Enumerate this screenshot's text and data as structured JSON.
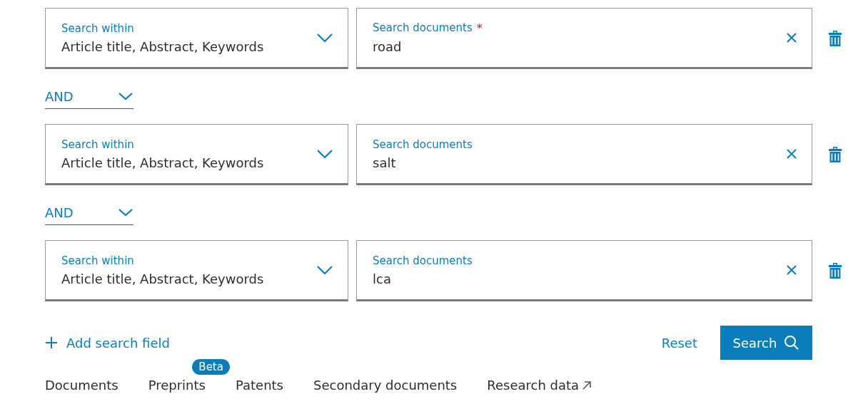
{
  "rows": [
    {
      "within": {
        "label": "Search within",
        "value": "Article title, Abstract, Keywords"
      },
      "query": {
        "label": "Search documents",
        "required_mark": "*",
        "value": "road"
      },
      "operator": "AND"
    },
    {
      "within": {
        "label": "Search within",
        "value": "Article title, Abstract, Keywords"
      },
      "query": {
        "label": "Search documents",
        "value": "salt"
      },
      "operator": "AND"
    },
    {
      "within": {
        "label": "Search within",
        "value": "Article title, Abstract, Keywords"
      },
      "query": {
        "label": "Search documents",
        "value": "lca"
      }
    }
  ],
  "add_field": "Add search field",
  "reset": "Reset",
  "search": "Search",
  "tabs": [
    {
      "label": "Documents",
      "kind": "plain"
    },
    {
      "label": "Preprints",
      "kind": "badge",
      "badge": "Beta"
    },
    {
      "label": "Patents",
      "kind": "plain"
    },
    {
      "label": "Secondary documents",
      "kind": "plain"
    },
    {
      "label": "Research data",
      "kind": "external"
    }
  ]
}
